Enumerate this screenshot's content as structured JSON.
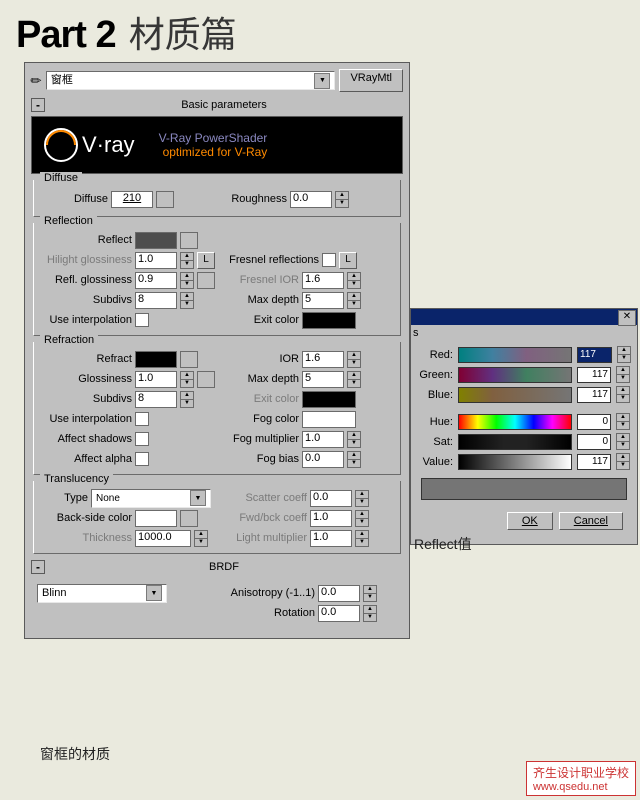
{
  "title": {
    "part": "Part 2",
    "chapter": "材质篇"
  },
  "header": {
    "material_name": "窗框",
    "material_type": "VRayMtl"
  },
  "rollout_basic": {
    "toggle": "-",
    "label": "Basic parameters"
  },
  "logo": {
    "brand": "V·ray",
    "line1": "V-Ray PowerShader",
    "line2": "optimized for V-Ray"
  },
  "diffuse": {
    "legend": "Diffuse",
    "diffuse_label": "Diffuse",
    "diffuse_value": "210",
    "roughness_label": "Roughness",
    "roughness_value": "0.0"
  },
  "reflection": {
    "legend": "Reflection",
    "reflect_label": "Reflect",
    "l_button": "L",
    "hilight_label": "Hilight glossiness",
    "hilight_value": "1.0",
    "refl_gloss_label": "Refl. glossiness",
    "refl_gloss_value": "0.9",
    "subdivs_label": "Subdivs",
    "subdivs_value": "8",
    "use_interp_label": "Use interpolation",
    "fresnel_label": "Fresnel reflections",
    "fresnel_ior_label": "Fresnel IOR",
    "fresnel_ior_value": "1.6",
    "max_depth_label": "Max depth",
    "max_depth_value": "5",
    "exit_color_label": "Exit color"
  },
  "refraction": {
    "legend": "Refraction",
    "refract_label": "Refract",
    "glossiness_label": "Glossiness",
    "glossiness_value": "1.0",
    "subdivs_label": "Subdivs",
    "subdivs_value": "8",
    "use_interp_label": "Use interpolation",
    "affect_shadows_label": "Affect shadows",
    "affect_alpha_label": "Affect alpha",
    "ior_label": "IOR",
    "ior_value": "1.6",
    "max_depth_label": "Max depth",
    "max_depth_value": "5",
    "exit_color_label": "Exit color",
    "fog_color_label": "Fog color",
    "fog_mult_label": "Fog multiplier",
    "fog_mult_value": "1.0",
    "fog_bias_label": "Fog bias",
    "fog_bias_value": "0.0"
  },
  "translucency": {
    "legend": "Translucency",
    "type_label": "Type",
    "type_value": "None",
    "back_side_label": "Back-side color",
    "thickness_label": "Thickness",
    "thickness_value": "1000.0",
    "scatter_label": "Scatter coeff",
    "scatter_value": "0.0",
    "fwdbck_label": "Fwd/bck coeff",
    "fwdbck_value": "1.0",
    "lightmult_label": "Light multiplier",
    "lightmult_value": "1.0"
  },
  "brdf": {
    "toggle": "-",
    "label": "BRDF",
    "type_value": "Blinn",
    "aniso_label": "Anisotropy (-1..1)",
    "aniso_value": "0.0",
    "rotation_label": "Rotation",
    "rotation_value": "0.0"
  },
  "color_picker": {
    "s_tab": "s",
    "red_label": "Red:",
    "green_label": "Green:",
    "blue_label": "Blue:",
    "hue_label": "Hue:",
    "sat_label": "Sat:",
    "value_label": "Value:",
    "red_value": "117",
    "green_value": "117",
    "blue_value": "117",
    "hue_value": "0",
    "sat_value": "0",
    "value_value": "117",
    "ok_label": "OK",
    "cancel_label": "Cancel"
  },
  "captions": {
    "bottom": "窗框的材质",
    "right": "Reflect值"
  },
  "watermark": {
    "title": "齐生设计职业学校",
    "url": "www.qsedu.net"
  }
}
